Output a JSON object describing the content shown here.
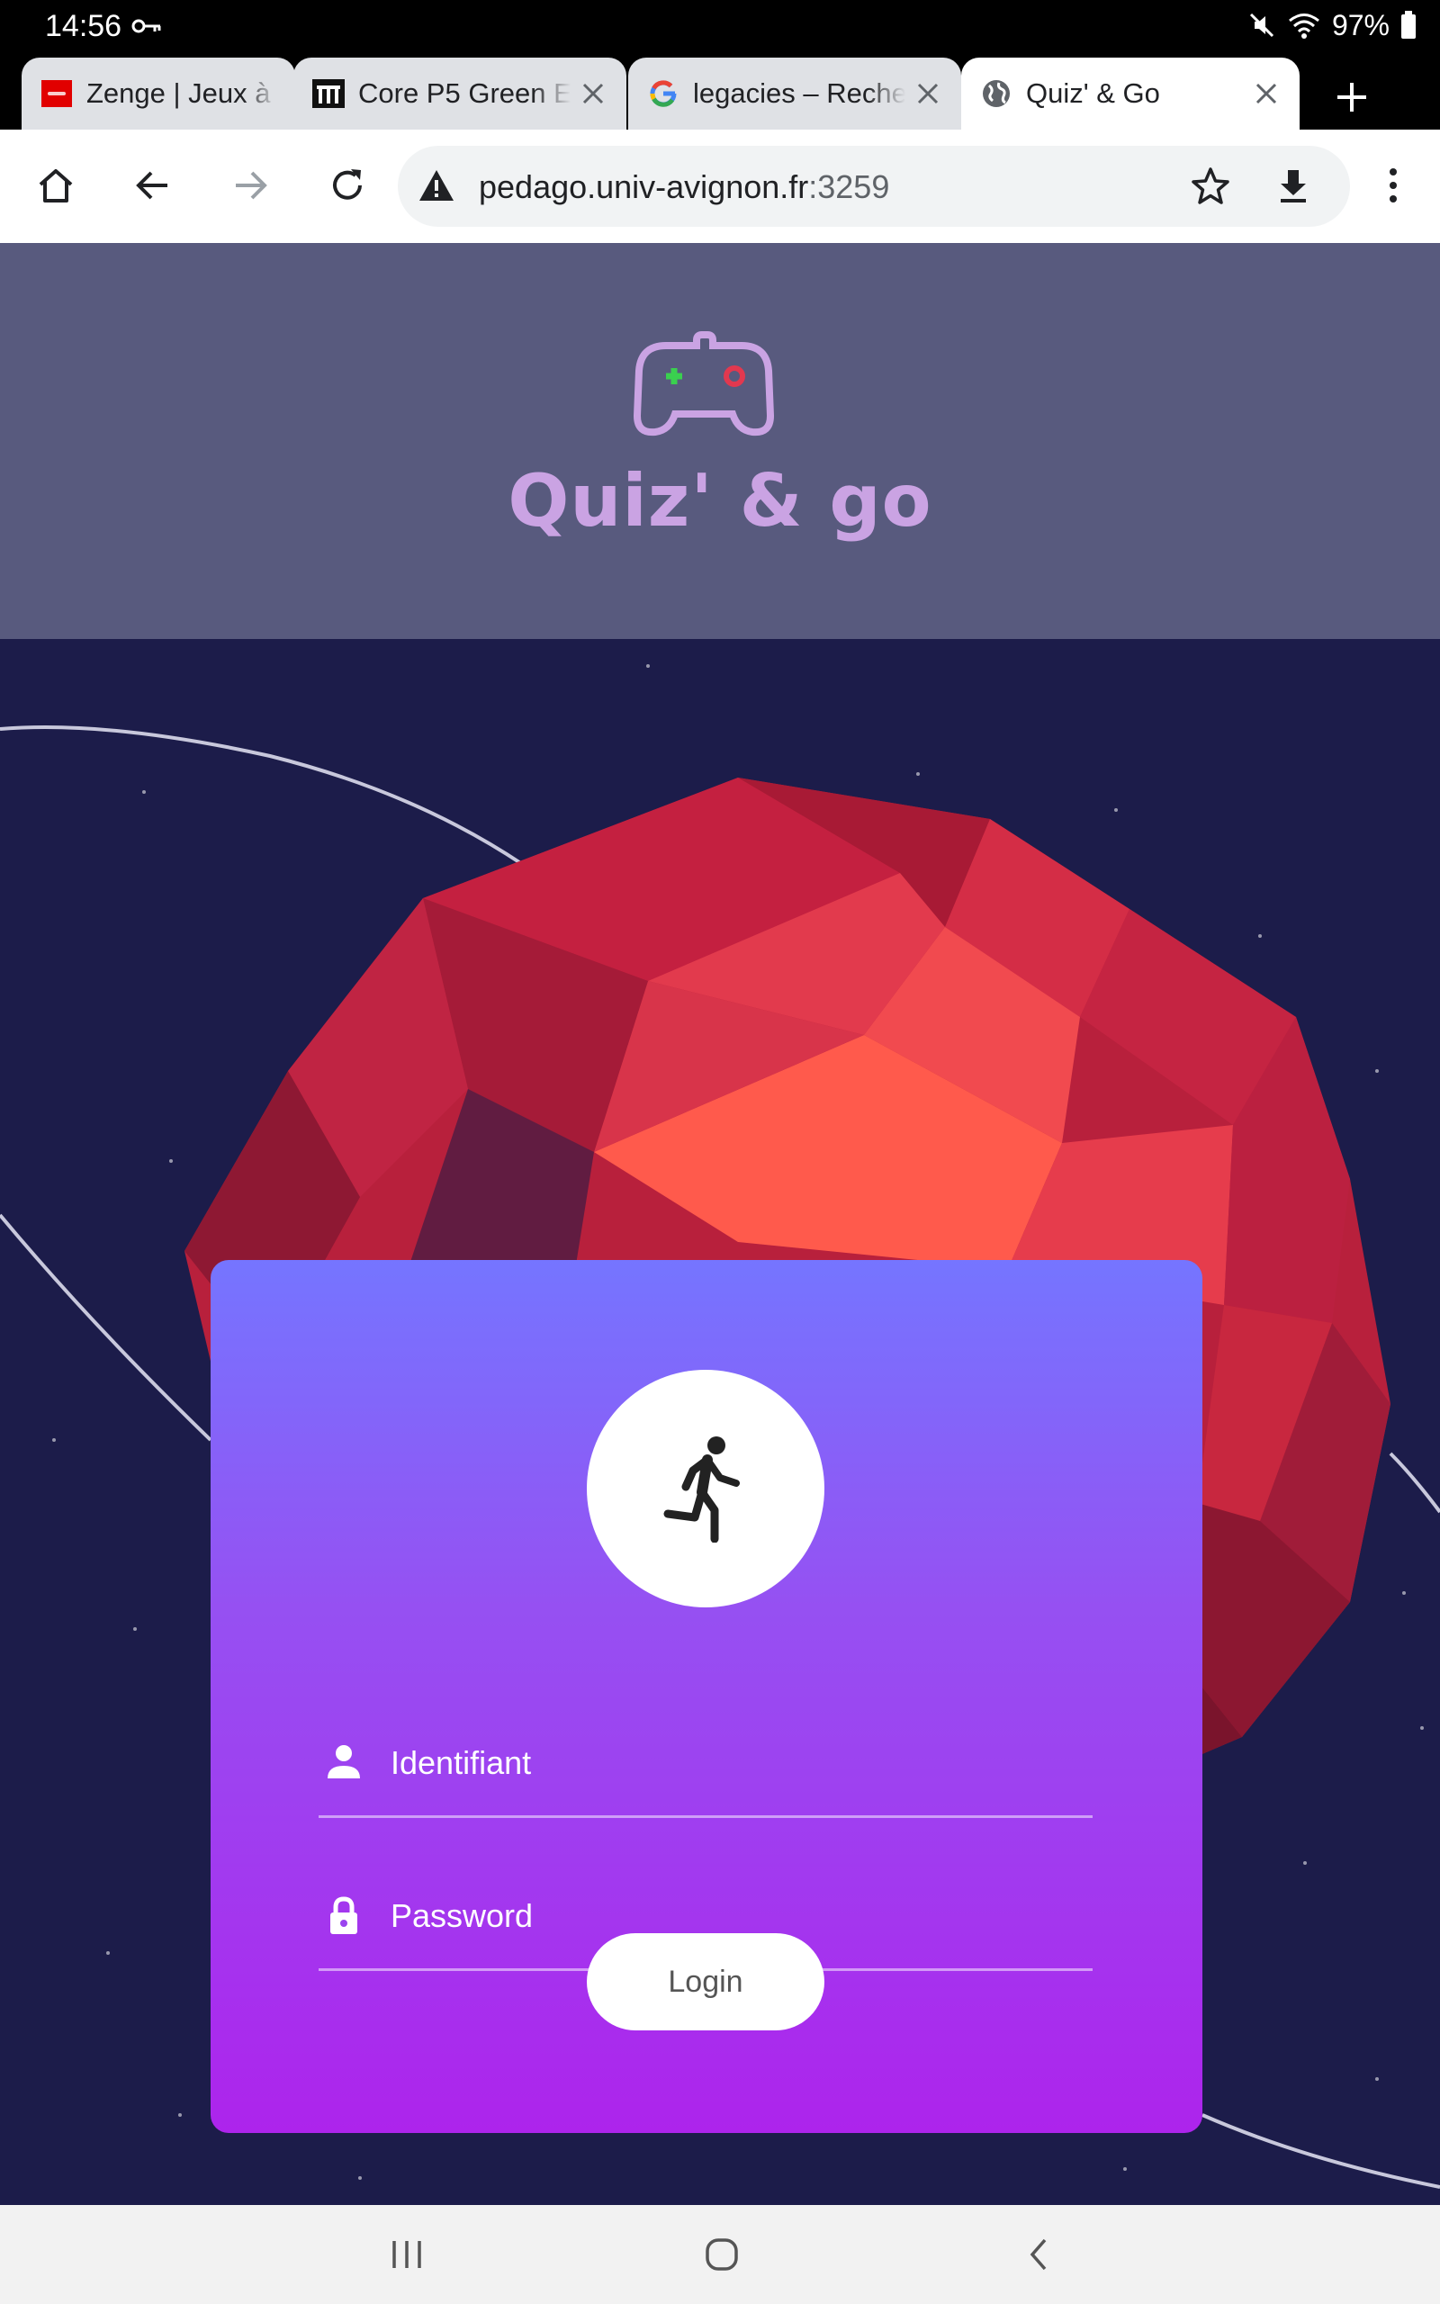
{
  "status_bar": {
    "time": "14:56",
    "battery": "97%",
    "icons": [
      "key-icon",
      "mute-icon",
      "wifi-icon",
      "battery-icon"
    ]
  },
  "tabs": [
    {
      "title": "Zenge | Jeux à",
      "favicon": "zenge-favicon",
      "active": false
    },
    {
      "title": "Core P5 Green E",
      "favicon": "thermaltake-favicon",
      "active": false
    },
    {
      "title": "legacies – Recherche",
      "favicon": "google-favicon",
      "active": false
    },
    {
      "title": "Quiz' & Go",
      "favicon": "globe-favicon",
      "active": true
    }
  ],
  "toolbar": {
    "url_host": "pedago.univ-avignon.fr",
    "url_port": ":3259",
    "icons": [
      "home-icon",
      "back-icon",
      "forward-icon",
      "reload-icon",
      "warning-icon",
      "star-icon",
      "download-icon",
      "menu-icon"
    ]
  },
  "page": {
    "logo_text": "Quiz' & go",
    "logo_icon": "gamepad-icon",
    "login": {
      "avatar_icon": "running-person-icon",
      "username_placeholder": "Identifiant",
      "password_placeholder": "Password",
      "login_label": "Login"
    }
  },
  "colors": {
    "header_band": "#585a7e",
    "background": "#1c1c4a",
    "planet": "#e2384f",
    "card_top": "#7575ff",
    "card_bottom": "#ad24ec",
    "logo": "#caa3e3"
  }
}
